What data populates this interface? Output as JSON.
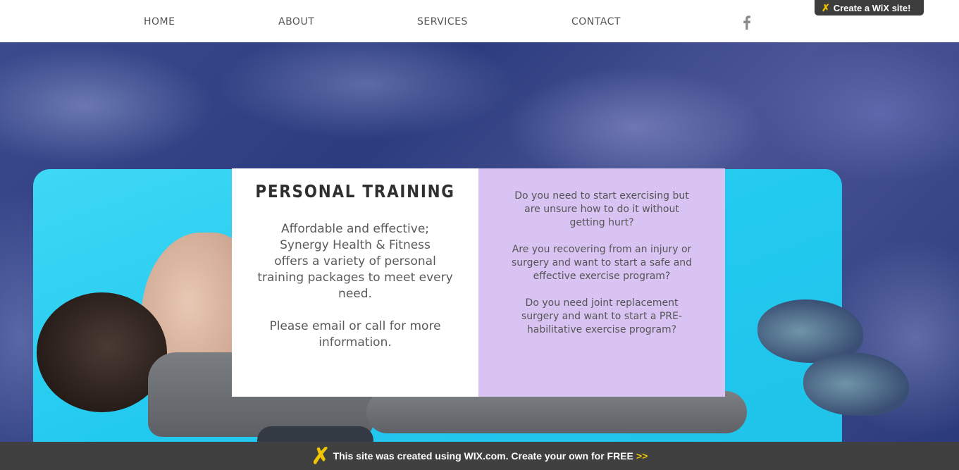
{
  "nav": {
    "items": [
      {
        "label": "HOME"
      },
      {
        "label": "ABOUT"
      },
      {
        "label": "SERVICES"
      },
      {
        "label": "CONTACT"
      }
    ],
    "social_icon": "facebook-icon"
  },
  "wix_badge": {
    "label": "Create a WiX site!"
  },
  "training": {
    "title": "PERSONAL TRAINING",
    "intro": "Affordable and effective;\nSynergy Health & Fitness\noffers a variety of personal\ntraining packages to meet every\nneed.",
    "contact_note": "Please email or call for more\ninformation."
  },
  "questions": [
    {
      "text": "Do you need to start exercising but are unsure how to do it without getting hurt?"
    },
    {
      "text": "Are you recovering from an injury or surgery and want to start a safe and effective exercise program?"
    },
    {
      "text": "Do you need joint replacement surgery and want to start a PRE-habilitative exercise program?"
    }
  ],
  "footer_banner": {
    "text": "This site was created using WIX.com. Create your own for FREE",
    "arrows": ">>"
  },
  "colors": {
    "lilac_panel": "#d8c3f3",
    "mat_cyan": "#22c9ef",
    "banner_bg": "#404040",
    "wix_yellow": "#f2c500"
  }
}
